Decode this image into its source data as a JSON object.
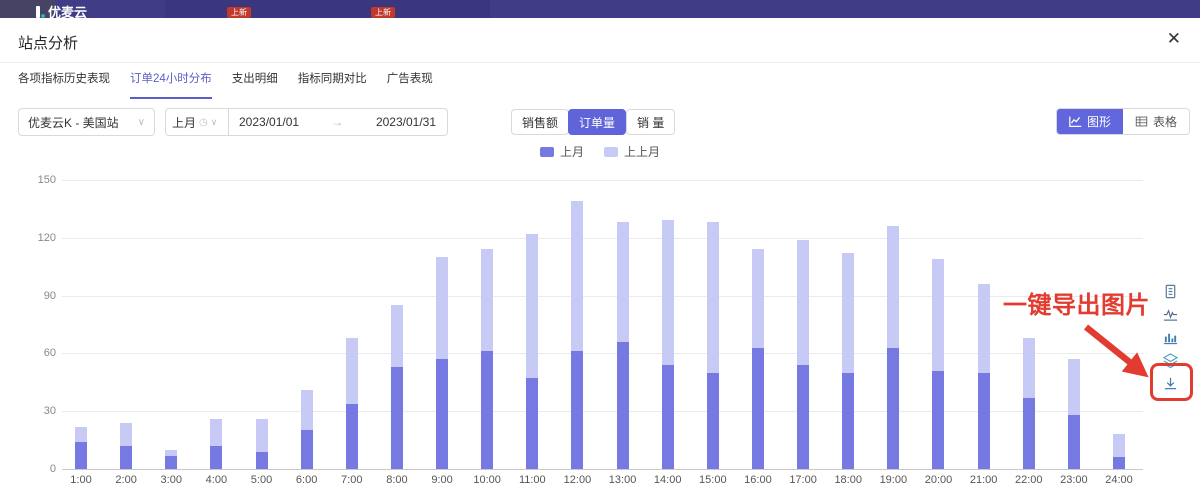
{
  "topbar": {
    "logo": "优麦云",
    "badge1": "上新",
    "badge2": "上新"
  },
  "modal": {
    "title": "站点分析",
    "close": "✕"
  },
  "tabs": [
    {
      "label": "各项指标历史表现",
      "active": false
    },
    {
      "label": "订单24小时分布",
      "active": true
    },
    {
      "label": "支出明细",
      "active": false
    },
    {
      "label": "指标同期对比",
      "active": false
    },
    {
      "label": "广告表现",
      "active": false
    }
  ],
  "filters": {
    "site": "优麦云K - 美国站",
    "preset": "上月",
    "date_start": "2023/01/01",
    "date_arrow": "→",
    "date_end": "2023/01/31"
  },
  "metric_buttons": [
    {
      "label": "销售额",
      "active": false
    },
    {
      "label": "订单量",
      "active": true
    },
    {
      "label": "销 量",
      "active": false
    }
  ],
  "view_toggle": [
    {
      "label": "图形",
      "active": true
    },
    {
      "label": "表格",
      "active": false
    }
  ],
  "annotation": {
    "text": "一键导出图片",
    "color": "#e23c30"
  },
  "toolbar_icons": [
    "data-view-icon",
    "line-chart-icon",
    "bar-chart-icon",
    "stack-icon",
    "download-icon"
  ],
  "colors": {
    "accent": "#5f64d9",
    "bar_last_month": "#7779e2",
    "bar_month_before": "#c7caf5",
    "topbar_bg": "#403c86",
    "annotation_red": "#e23c30"
  },
  "chart_data": {
    "type": "bar",
    "stacked": true,
    "categories": [
      "1:00",
      "2:00",
      "3:00",
      "4:00",
      "5:00",
      "6:00",
      "7:00",
      "8:00",
      "9:00",
      "10:00",
      "11:00",
      "12:00",
      "13:00",
      "14:00",
      "15:00",
      "16:00",
      "17:00",
      "18:00",
      "19:00",
      "20:00",
      "21:00",
      "22:00",
      "23:00",
      "24:00"
    ],
    "series": [
      {
        "name": "上月",
        "color": "#7779e2",
        "values": [
          14,
          12,
          7,
          12,
          9,
          20,
          34,
          53,
          57,
          61,
          47,
          61,
          66,
          54,
          50,
          63,
          54,
          50,
          63,
          51,
          50,
          37,
          28,
          6
        ]
      },
      {
        "name": "上上月",
        "color": "#c7caf5",
        "values": [
          8,
          12,
          3,
          14,
          17,
          21,
          34,
          32,
          53,
          53,
          75,
          78,
          62,
          75,
          78,
          51,
          65,
          62,
          63,
          58,
          46,
          31,
          29,
          12
        ]
      }
    ],
    "title": "",
    "xlabel": "",
    "ylabel": "",
    "ylim": [
      0,
      150
    ],
    "yticks": [
      0,
      30,
      60,
      90,
      120,
      150
    ],
    "grid": true,
    "legend_position": "top-center"
  }
}
